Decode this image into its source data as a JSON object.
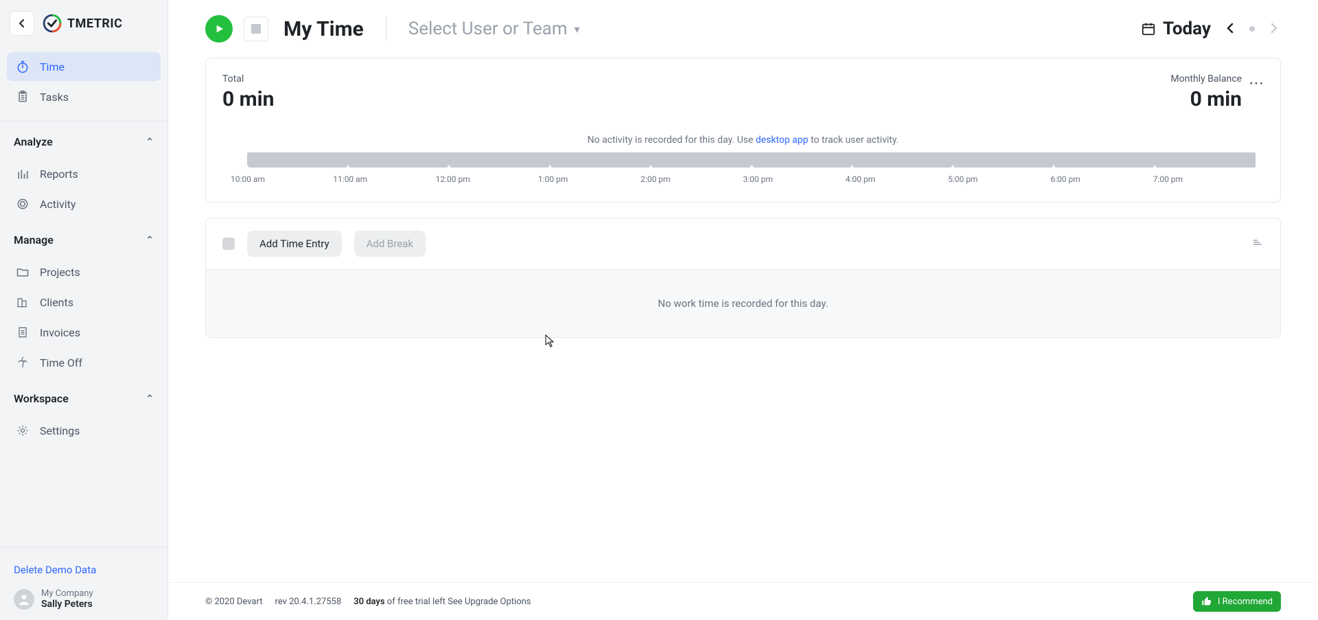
{
  "brand": "TMETRIC",
  "sidebar": {
    "items": [
      {
        "label": "Time"
      },
      {
        "label": "Tasks"
      }
    ],
    "analyze": {
      "title": "Analyze",
      "items": [
        {
          "label": "Reports"
        },
        {
          "label": "Activity"
        }
      ]
    },
    "manage": {
      "title": "Manage",
      "items": [
        {
          "label": "Projects"
        },
        {
          "label": "Clients"
        },
        {
          "label": "Invoices"
        },
        {
          "label": "Time Off"
        }
      ]
    },
    "workspace": {
      "title": "Workspace",
      "items": [
        {
          "label": "Settings"
        }
      ]
    },
    "delete_demo": "Delete Demo Data",
    "profile": {
      "company": "My Company",
      "name": "Sally Peters"
    }
  },
  "header": {
    "title": "My Time",
    "user_selector": "Select User or Team",
    "date_label": "Today"
  },
  "summary": {
    "total_label": "Total",
    "total_value": "0 min",
    "balance_label": "Monthly Balance",
    "balance_value": "0 min",
    "no_activity_pre": "No activity is recorded for this day. Use ",
    "no_activity_link": "desktop app",
    "no_activity_post": " to track user activity.",
    "timeline_labels": [
      "10:00 am",
      "11:00 am",
      "12:00 pm",
      "1:00 pm",
      "2:00 pm",
      "3:00 pm",
      "4:00 pm",
      "5:00 pm",
      "6:00 pm",
      "7:00 pm"
    ]
  },
  "entries": {
    "add_entry": "Add Time Entry",
    "add_break": "Add Break",
    "empty": "No work time is recorded for this day."
  },
  "footer": {
    "copyright": "© 2020 Devart",
    "rev": "rev 20.4.1.27558",
    "trial_days": "30 days",
    "trial_msg": " of free trial left See Upgrade Options",
    "recommend": "I Recommend"
  }
}
